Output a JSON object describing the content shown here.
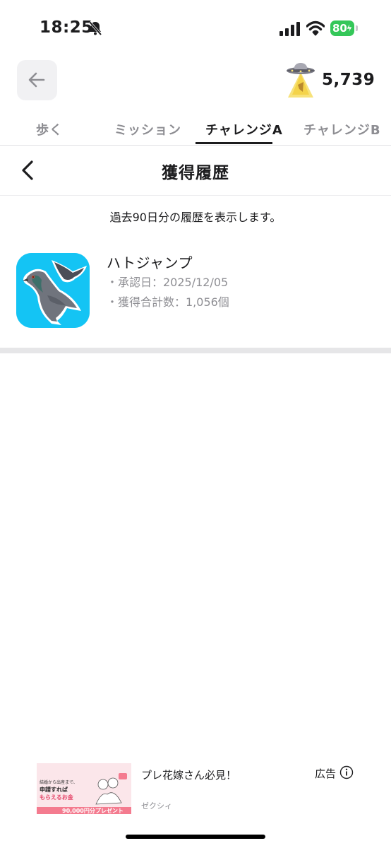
{
  "status_bar": {
    "time": "18:25",
    "battery": "80"
  },
  "header": {
    "coins": "5,739"
  },
  "tabs": [
    {
      "label": "歩く",
      "active": false
    },
    {
      "label": "ミッション",
      "active": false
    },
    {
      "label": "チャレンジA",
      "active": true
    },
    {
      "label": "チャレンジB",
      "active": false
    }
  ],
  "section": {
    "title": "獲得履歴",
    "info": "過去90日分の履歴を表示します。"
  },
  "history": [
    {
      "name": "ハトジャンプ",
      "approved": "・承認日：2025/12/05",
      "total": "・獲得合計数：1,056個"
    }
  ],
  "ad": {
    "title": "プレ花嫁さん必見！",
    "source": "ゼクシィ",
    "label": "広告",
    "image_lines": [
      "結婚から出産まで、",
      "申請すれば",
      "もらえるお金",
      "90,000円分プレゼント"
    ]
  },
  "icons": {
    "back": "arrow-left-icon",
    "section_back": "chevron-left-icon",
    "ufo": "ufo-icon",
    "info": "info-circle-icon",
    "bell": "bell-slash-icon"
  }
}
